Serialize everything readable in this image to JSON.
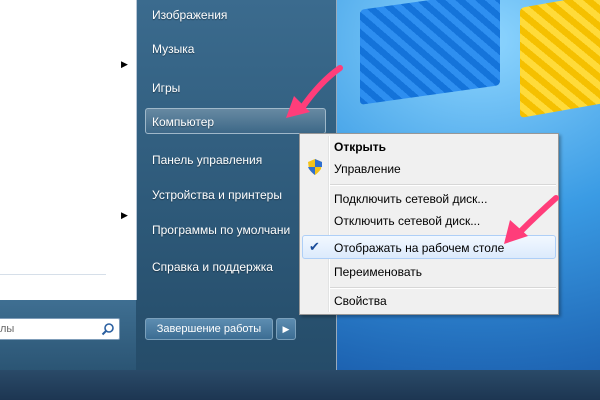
{
  "left_pane": {
    "search_placeholder": "лы"
  },
  "right_column": {
    "items": [
      {
        "label": "Изображения"
      },
      {
        "label": "Музыка"
      },
      {
        "label": "Игры"
      },
      {
        "label": "Компьютер"
      },
      {
        "label": "Панель управления"
      },
      {
        "label": "Устройства и принтеры"
      },
      {
        "label": "Программы по умолчани"
      },
      {
        "label": "Справка и поддержка"
      }
    ],
    "shutdown_label": "Завершение работы"
  },
  "context_menu": {
    "items": [
      {
        "label": "Открыть"
      },
      {
        "label": "Управление"
      },
      {
        "label": "Подключить сетевой диск..."
      },
      {
        "label": "Отключить сетевой диск..."
      },
      {
        "label": "Отображать на рабочем столе"
      },
      {
        "label": "Переименовать"
      },
      {
        "label": "Свойства"
      }
    ]
  },
  "colors": {
    "annotation_arrow": "#ff3d7a",
    "highlight_border": "#aecff7"
  },
  "icons": {
    "search": "search-icon",
    "shield": "shield-icon",
    "check": "check-icon"
  }
}
